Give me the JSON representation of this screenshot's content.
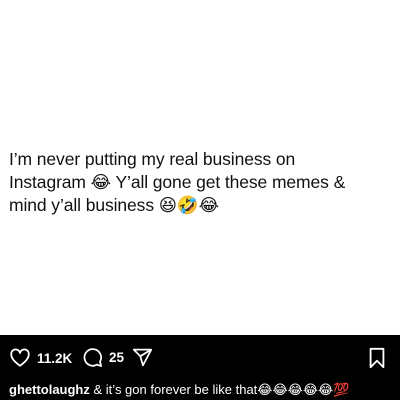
{
  "post": {
    "text": "I’m never putting my real business on\nInstagram 😂 Y’all gone get these memes &\nmind y’all business 😆🤣😂"
  },
  "actions": {
    "likes": "11.2K",
    "comments": "25",
    "like_icon": "heart-icon",
    "comment_icon": "comment-icon",
    "share_icon": "share-icon",
    "bookmark_icon": "bookmark-icon"
  },
  "caption": {
    "username": "ghettolaughz",
    "text": " & it’s gon forever be like that😂😂😂😂😂💯"
  },
  "colors": {
    "background": "#000000",
    "post_background": "#ffffff",
    "post_text": "#111111",
    "ui_text": "#ffffff"
  }
}
